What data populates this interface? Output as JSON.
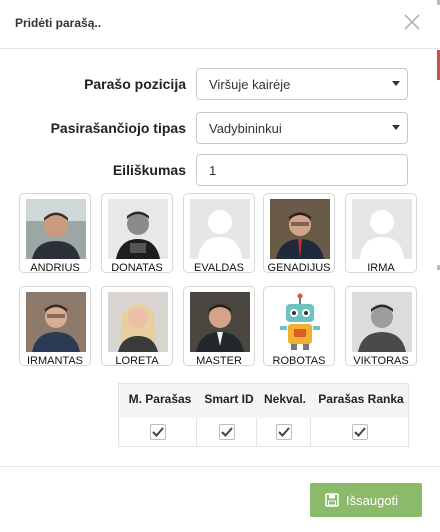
{
  "dialog": {
    "title": "Pridėti parašą..",
    "close_icon": "close-icon"
  },
  "form": {
    "position_label": "Parašo pozicija",
    "position_value": "Viršuje kairėje",
    "signer_type_label": "Pasirašančiojo tipas",
    "signer_type_value": "Vadybininkui",
    "order_label": "Eiliškumas",
    "order_value": "1"
  },
  "signers": [
    {
      "name": "ANDRIUS",
      "photo": "photo"
    },
    {
      "name": "DONATAS",
      "photo": "photo"
    },
    {
      "name": "EVALDAS",
      "photo": "placeholder"
    },
    {
      "name": "GENADIJUS",
      "photo": "photo"
    },
    {
      "name": "IRMA",
      "photo": "placeholder"
    },
    {
      "name": "IRMANTAS",
      "photo": "photo"
    },
    {
      "name": "LORETA",
      "photo": "photo"
    },
    {
      "name": "MASTER",
      "photo": "photo"
    },
    {
      "name": "ROBOTAS",
      "photo": "robot"
    },
    {
      "name": "VIKTORAS",
      "photo": "photo"
    }
  ],
  "signature_table": {
    "headers": [
      "M. Parašas",
      "Smart ID",
      "Nekval.",
      "Parašas Ranka"
    ],
    "checked": [
      true,
      true,
      true,
      true
    ]
  },
  "footer": {
    "save_label": "Išsaugoti",
    "save_icon": "floppy-disk-icon"
  },
  "colors": {
    "accent": "#8bbb6a",
    "border": "#d6d6d6"
  }
}
